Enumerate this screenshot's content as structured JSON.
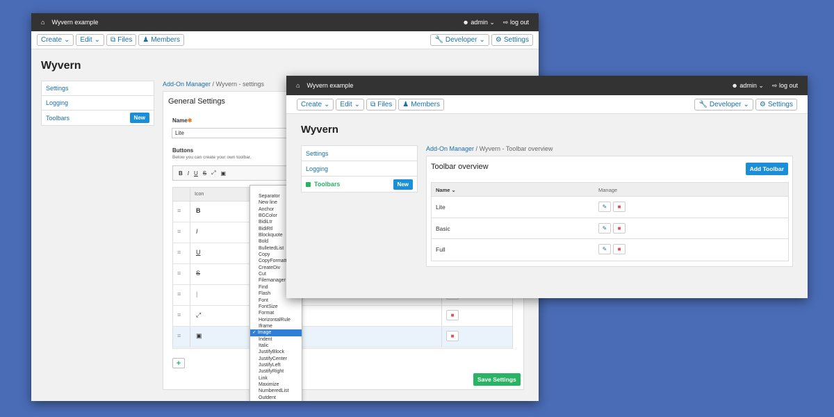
{
  "app": {
    "title": "Wyvern example",
    "user": "admin",
    "logout": "log out",
    "brand": "Wyvern",
    "nav": {
      "create": "Create",
      "edit": "Edit",
      "files": "Files",
      "members": "Members",
      "developer": "Developer",
      "settings": "Settings"
    }
  },
  "sidebar": {
    "items": [
      {
        "label": "Settings"
      },
      {
        "label": "Logging"
      },
      {
        "label": "Toolbars",
        "badge": "New"
      }
    ]
  },
  "back": {
    "breadcrumb": {
      "parent": "Add-On Manager",
      "current": "Wyvern - settings"
    },
    "panel_title": "General Settings",
    "name_label": "Name",
    "name_value": "Lite",
    "buttons_label": "Buttons",
    "buttons_help": "Below you can create your own toolbar.",
    "editor_buttons": [
      "B",
      "I",
      "U",
      "S"
    ],
    "table_header_icon": "Icon",
    "rows": [
      {
        "icon": "B"
      },
      {
        "icon": "I"
      },
      {
        "icon": "U"
      },
      {
        "icon": "S"
      },
      {
        "icon": "|"
      },
      {
        "icon": "maximize-icon"
      },
      {
        "icon": "image-icon"
      }
    ],
    "save_label": "Save Settings",
    "dropdown": {
      "options": [
        "Separator",
        "New line",
        "Anchor",
        "BGColor",
        "BidiLtr",
        "BidiRtl",
        "Blockquote",
        "Bold",
        "BulletedList",
        "Copy",
        "CopyFormatting",
        "CreateDiv",
        "Cut",
        "Filemanager",
        "Find",
        "Flash",
        "Font",
        "FontSize",
        "Format",
        "HorizontalRule",
        "Iframe",
        "Image",
        "Indent",
        "Italic",
        "JustifyBlock",
        "JustifyCenter",
        "JustifyLeft",
        "JustifyRight",
        "Link",
        "Maximize",
        "NumberedList",
        "Outdent"
      ],
      "selected": "Image"
    }
  },
  "front": {
    "breadcrumb": {
      "parent": "Add-On Manager",
      "current": "Wyvern - Toolbar overview"
    },
    "panel_title": "Toolbar overview",
    "add_label": "Add Toolbar",
    "col_name": "Name",
    "col_manage": "Manage",
    "rows": [
      {
        "name": "Lite"
      },
      {
        "name": "Basic"
      },
      {
        "name": "Full"
      }
    ]
  },
  "colors": {
    "background": "#4a6cb6",
    "topbar": "#333333",
    "accent": "#1a8fd8",
    "success": "#28b463",
    "danger": "#d9534f",
    "link": "#1a6fa8"
  }
}
